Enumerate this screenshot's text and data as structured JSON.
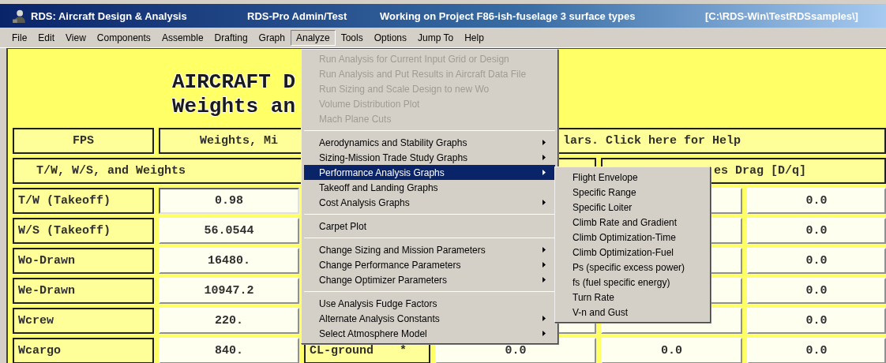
{
  "window": {
    "title": "RDS: Aircraft Design & Analysis",
    "user": "RDS-Pro Admin/Test",
    "project": "Working on Project  F86-ish-fuselage 3 surface types",
    "path": "[C:\\RDS-Win\\TestRDSsamples\\]"
  },
  "menu_bar": [
    {
      "label": "File",
      "selected": false
    },
    {
      "label": "Edit",
      "selected": false
    },
    {
      "label": "View",
      "selected": false
    },
    {
      "label": "Components",
      "selected": false
    },
    {
      "label": "Assemble",
      "selected": false
    },
    {
      "label": "Drafting",
      "selected": false
    },
    {
      "label": "Graph",
      "selected": false
    },
    {
      "label": "Analyze",
      "selected": true
    },
    {
      "label": "Tools",
      "selected": false
    },
    {
      "label": "Options",
      "selected": false
    },
    {
      "label": "Jump To",
      "selected": false
    },
    {
      "label": "Help",
      "selected": false
    }
  ],
  "heading": {
    "line_1": "AIRCRAFT D",
    "line_2": "Weights an"
  },
  "form": {
    "header_row": {
      "units": "FPS",
      "column_2": "Weights, Mi",
      "column_5": "lars.  Click here for Help"
    },
    "section_row": {
      "left": "T/W, W/S, and Weights",
      "right": "es Drag  [D/q]"
    },
    "rows": [
      {
        "label": "T/W (Takeoff)",
        "value": "0.98",
        "focused": true,
        "column_6": "0.0"
      },
      {
        "label": "W/S (Takeoff)",
        "value": "56.0544",
        "focused": false,
        "column_6": "0.0"
      },
      {
        "label": "Wo-Drawn",
        "value": "16480.",
        "focused": false,
        "column_6": "0.0"
      },
      {
        "label": "We-Drawn",
        "value": "10947.2",
        "focused": false,
        "column_6": "0.0"
      },
      {
        "label": "Wcrew",
        "value": "220.",
        "focused": false,
        "column_6": "0.0"
      },
      {
        "label": "Wcargo",
        "value": "840.",
        "focused": false,
        "column_3": "CL-ground",
        "column_3_mark": "*",
        "column_4": "0.0",
        "column_5": "0.0",
        "column_6": "0.0"
      }
    ]
  },
  "dropdown_menu": {
    "items": [
      {
        "kind": "item",
        "label": "Run Analysis for Current Input Grid or Design",
        "disabled": true,
        "submenu": false,
        "selected": false
      },
      {
        "kind": "item",
        "label": "Run Analysis and Put Results in Aircraft Data File",
        "disabled": true,
        "submenu": false,
        "selected": false
      },
      {
        "kind": "item",
        "label": "Run Sizing and Scale Design to new Wo",
        "disabled": true,
        "submenu": false,
        "selected": false
      },
      {
        "kind": "item",
        "label": "Volume Distribution Plot",
        "disabled": true,
        "submenu": false,
        "selected": false
      },
      {
        "kind": "item",
        "label": "Mach Plane Cuts",
        "disabled": true,
        "submenu": false,
        "selected": false
      },
      {
        "kind": "separator"
      },
      {
        "kind": "item",
        "label": "Aerodynamics and Stability Graphs",
        "disabled": false,
        "submenu": true,
        "selected": false
      },
      {
        "kind": "item",
        "label": "Sizing-Mission Trade Study Graphs",
        "disabled": false,
        "submenu": true,
        "selected": false
      },
      {
        "kind": "item",
        "label": "Performance Analysis Graphs",
        "disabled": false,
        "submenu": true,
        "selected": true
      },
      {
        "kind": "item",
        "label": "Takeoff and Landing Graphs",
        "disabled": false,
        "submenu": false,
        "selected": false
      },
      {
        "kind": "item",
        "label": "Cost Analysis Graphs",
        "disabled": false,
        "submenu": true,
        "selected": false
      },
      {
        "kind": "separator"
      },
      {
        "kind": "item",
        "label": "Carpet Plot",
        "disabled": false,
        "submenu": false,
        "selected": false
      },
      {
        "kind": "separator"
      },
      {
        "kind": "item",
        "label": "Change Sizing and Mission Parameters",
        "disabled": false,
        "submenu": true,
        "selected": false
      },
      {
        "kind": "item",
        "label": "Change Performance Parameters",
        "disabled": false,
        "submenu": true,
        "selected": false
      },
      {
        "kind": "item",
        "label": "Change Optimizer Parameters",
        "disabled": false,
        "submenu": true,
        "selected": false
      },
      {
        "kind": "separator"
      },
      {
        "kind": "item",
        "label": "Use Analysis Fudge Factors",
        "disabled": false,
        "submenu": false,
        "selected": false
      },
      {
        "kind": "item",
        "label": "Alternate Analysis Constants",
        "disabled": false,
        "submenu": true,
        "selected": false
      },
      {
        "kind": "item",
        "label": "Select Atmosphere Model",
        "disabled": false,
        "submenu": true,
        "selected": false
      }
    ]
  },
  "submenu": {
    "items": [
      {
        "label": "Flight Envelope"
      },
      {
        "label": "Specific Range"
      },
      {
        "label": "Specific Loiter"
      },
      {
        "label": "Climb Rate and Gradient"
      },
      {
        "label": "Climb Optimization-Time"
      },
      {
        "label": "Climb Optimization-Fuel"
      },
      {
        "label": "Ps (specific excess power)"
      },
      {
        "label": "fs (fuel specific energy)"
      },
      {
        "label": "Turn Rate"
      },
      {
        "label": "V-n and Gust"
      }
    ]
  }
}
